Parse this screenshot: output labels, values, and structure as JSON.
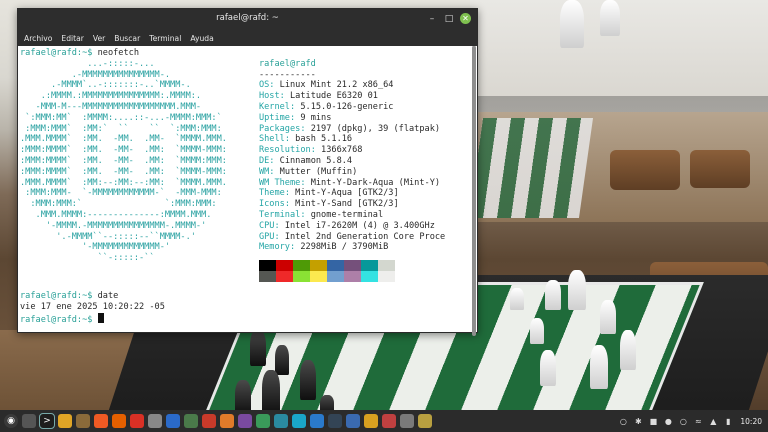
{
  "window": {
    "title": "rafael@rafd: ~",
    "menu": [
      "Archivo",
      "Editar",
      "Ver",
      "Buscar",
      "Terminal",
      "Ayuda"
    ]
  },
  "terminal": {
    "prompt1": "rafael@rafd:~$ ",
    "cmd1": "neofetch",
    "logo": [
      "             ...-:::::-...",
      "          .-MMMMMMMMMMMMMMM-.",
      "      .-MMMM`..-:::::::-..`MMMM-.",
      "    .:MMMM.:MMMMMMMMMMMMMMM:.MMMM:.",
      "   -MMM-M---MMMMMMMMMMMMMMMMMM.MMM-",
      " `:MMM:MM`  :MMMM:....::-...-MMMM:MMM:`",
      " :MMM:MMM`  :MM:`  ``    ``  `:MMM:MMM:",
      ".MMM.MMMM`  :MM.  -MM.  .MM-  `MMMM.MMM.",
      ":MMM:MMMM`  :MM.  -MM-  .MM:  `MMMM-MMM:",
      ":MMM:MMMM`  :MM.  -MM-  .MM:  `MMMM:MMM:",
      ":MMM:MMMM`  :MM.  -MM-  .MM:  `MMMM-MMM:",
      ".MMM.MMMM`  :MM:--:MM:--:MM:  `MMMM.MMM.",
      " :MMM:MMM-  `-MMMMMMMMMMMM-`  -MMM-MMM:",
      "  :MMM:MMM:`                `:MMM:MMM:",
      "   .MMM.MMMM:--------------:MMMM.MMM.",
      "     '-MMMM.-MMMMMMMMMMMMMMM-.MMMM-'",
      "       '.-MMMM``--:::::--``MMMM-.'",
      "            '-MMMMMMMMMMMMM-'",
      "               ``-:::::-``"
    ],
    "info_header": "rafael@rafd",
    "info_separator": "-----------",
    "info": [
      {
        "key": "OS",
        "value": "Linux Mint 21.2 x86_64"
      },
      {
        "key": "Host",
        "value": "Latitude E6320 01"
      },
      {
        "key": "Kernel",
        "value": "5.15.0-126-generic"
      },
      {
        "key": "Uptime",
        "value": "9 mins"
      },
      {
        "key": "Packages",
        "value": "2197 (dpkg), 39 (flatpak)"
      },
      {
        "key": "Shell",
        "value": "bash 5.1.16"
      },
      {
        "key": "Resolution",
        "value": "1366x768"
      },
      {
        "key": "DE",
        "value": "Cinnamon 5.8.4"
      },
      {
        "key": "WM",
        "value": "Mutter (Muffin)"
      },
      {
        "key": "WM Theme",
        "value": "Mint-Y-Dark-Aqua (Mint-Y)"
      },
      {
        "key": "Theme",
        "value": "Mint-Y-Aqua [GTK2/3]"
      },
      {
        "key": "Icons",
        "value": "Mint-Y-Sand [GTK2/3]"
      },
      {
        "key": "Terminal",
        "value": "gnome-terminal"
      },
      {
        "key": "CPU",
        "value": "Intel i7-2620M (4) @ 3.400GHz"
      },
      {
        "key": "GPU",
        "value": "Intel 2nd Generation Core Proce"
      },
      {
        "key": "Memory",
        "value": "2298MiB / 3790MiB"
      }
    ],
    "palette_row1": [
      "#000000",
      "#cc0000",
      "#4e9a06",
      "#c4a000",
      "#3465a4",
      "#75507b",
      "#06989a",
      "#d3d7cf"
    ],
    "palette_row2": [
      "#555753",
      "#ef2929",
      "#8ae234",
      "#fce94f",
      "#729fcf",
      "#ad7fa8",
      "#34e2e2",
      "#eeeeec"
    ],
    "prompt2": "rafael@rafd:~$ ",
    "cmd2": "date",
    "date_output": "vie 17 ene 2025 10:20:22 -05",
    "prompt3": "rafael@rafd:~$ "
  },
  "taskbar": {
    "icons": [
      {
        "name": "menu-icon",
        "color": "#3a3a3a"
      },
      {
        "name": "show-desktop-icon",
        "color": "#555555"
      },
      {
        "name": "terminal-icon",
        "color": "#1e1e1e"
      },
      {
        "name": "files-icon",
        "color": "#e0a526"
      },
      {
        "name": "files-home-icon",
        "color": "#8a6a3a"
      },
      {
        "name": "brave-browser-icon",
        "color": "#f05a24"
      },
      {
        "name": "firefox-icon",
        "color": "#e66000"
      },
      {
        "name": "chromium-icon",
        "color": "#d93025"
      },
      {
        "name": "text-editor-icon",
        "color": "#888888"
      },
      {
        "name": "app-blue-icon",
        "color": "#2a6ac9"
      },
      {
        "name": "app-grid-icon",
        "color": "#4a7a4a"
      },
      {
        "name": "app-red-icon",
        "color": "#c83a2a"
      },
      {
        "name": "app-orange-icon",
        "color": "#e07b2a"
      },
      {
        "name": "app-purple-icon",
        "color": "#7a4aa0"
      },
      {
        "name": "app-green-icon",
        "color": "#3a9a5a"
      },
      {
        "name": "app-teal-icon",
        "color": "#2a8aa0"
      },
      {
        "name": "app-cyan-icon",
        "color": "#1aa6c8"
      },
      {
        "name": "vscode-icon",
        "color": "#2a7acc"
      },
      {
        "name": "app-dark-icon",
        "color": "#334455"
      },
      {
        "name": "app-chart-icon",
        "color": "#3a6ab0"
      },
      {
        "name": "app-pencil-icon",
        "color": "#d8a020"
      },
      {
        "name": "app-wave-icon",
        "color": "#c04040"
      },
      {
        "name": "app-disc-icon",
        "color": "#7a7a7a"
      },
      {
        "name": "app-gear-icon",
        "color": "#b8a040"
      }
    ],
    "clock": "10:20"
  }
}
